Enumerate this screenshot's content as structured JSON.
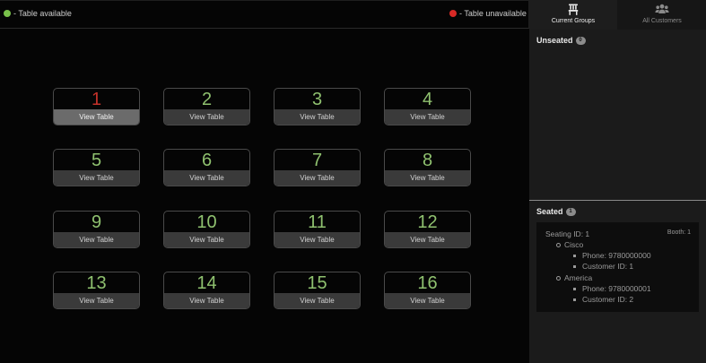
{
  "legend": {
    "available": "- Table available",
    "unavailable": "- Table unavailable"
  },
  "tables": [
    {
      "number": "1",
      "available": false,
      "view_label": "View Table",
      "selected": true
    },
    {
      "number": "2",
      "available": true,
      "view_label": "View Table"
    },
    {
      "number": "3",
      "available": true,
      "view_label": "View Table"
    },
    {
      "number": "4",
      "available": true,
      "view_label": "View Table"
    },
    {
      "number": "5",
      "available": true,
      "view_label": "View Table"
    },
    {
      "number": "6",
      "available": true,
      "view_label": "View Table"
    },
    {
      "number": "7",
      "available": true,
      "view_label": "View Table"
    },
    {
      "number": "8",
      "available": true,
      "view_label": "View Table"
    },
    {
      "number": "9",
      "available": true,
      "view_label": "View Table"
    },
    {
      "number": "10",
      "available": true,
      "view_label": "View Table"
    },
    {
      "number": "11",
      "available": true,
      "view_label": "View Table"
    },
    {
      "number": "12",
      "available": true,
      "view_label": "View Table"
    },
    {
      "number": "13",
      "available": true,
      "view_label": "View Table"
    },
    {
      "number": "14",
      "available": true,
      "view_label": "View Table"
    },
    {
      "number": "15",
      "available": true,
      "view_label": "View Table"
    },
    {
      "number": "16",
      "available": true,
      "view_label": "View Table"
    }
  ],
  "sidebar": {
    "tabs": [
      {
        "label": "Current Groups",
        "icon": "chair-icon",
        "active": true
      },
      {
        "label": "All Customers",
        "icon": "users-icon",
        "active": false
      }
    ],
    "unseated": {
      "title": "Unseated",
      "count": "0"
    },
    "seated": {
      "title": "Seated",
      "count": "1",
      "seating": {
        "seating_id": "Seating ID: 1",
        "booth": "Booth: 1",
        "groups": [
          {
            "name": "Cisco",
            "phone": "Phone: 9780000000",
            "customer_id": "Customer ID: 1"
          },
          {
            "name": "America",
            "phone": "Phone: 9780000001",
            "customer_id": "Customer ID: 2"
          }
        ]
      }
    }
  },
  "colors": {
    "available": "#79c14a",
    "unavailable": "#d82a26"
  }
}
